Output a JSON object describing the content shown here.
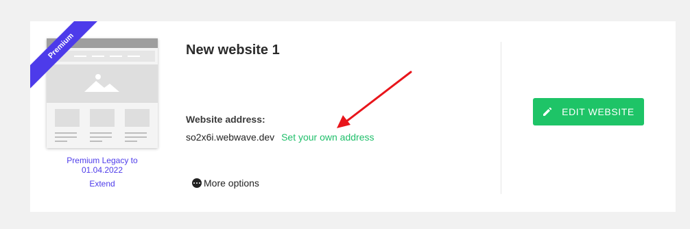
{
  "card": {
    "badge": "Premium",
    "title": "New website 1",
    "plan_line1": "Premium Legacy to",
    "plan_line2": "01.04.2022",
    "extend": "Extend",
    "address_label": "Website address:",
    "address": "so2x6i.webwave.dev",
    "own_address_link": "Set your own address",
    "more_options": "More options",
    "edit_button": "EDIT WEBSITE"
  },
  "colors": {
    "accent_purple": "#4d3bea",
    "accent_green": "#1ec467",
    "link_green": "#1fbf6a",
    "annotation_red": "#e8151b"
  },
  "icons": {
    "more": "more-horizontal-circle-icon",
    "edit": "pencil-icon",
    "thumbnail": "image-placeholder-icon"
  }
}
